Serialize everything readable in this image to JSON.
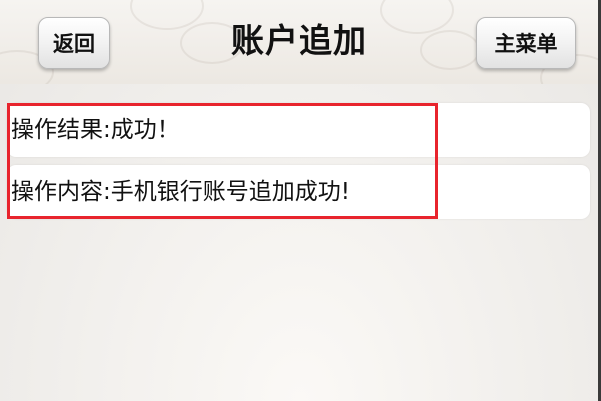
{
  "header": {
    "title": "账户追加",
    "back_label": "返回",
    "menu_label": "主菜单"
  },
  "results": {
    "result_label": "操作结果:",
    "result_value": "成功！",
    "content_label": "操作内容:",
    "content_value": "手机银行账号追加成功!"
  },
  "colors": {
    "highlight": "#e8242d"
  }
}
